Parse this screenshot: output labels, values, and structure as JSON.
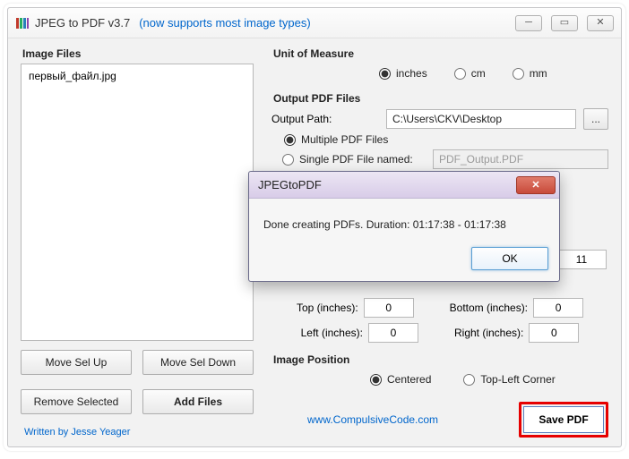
{
  "window": {
    "title": "JPEG to PDF  v3.7",
    "subtitle": "(now supports most image types)"
  },
  "leftpanel": {
    "header": "Image Files",
    "file0": "первый_файл.jpg",
    "move_up": "Move Sel Up",
    "move_down": "Move Sel Down",
    "remove": "Remove Selected",
    "add": "Add Files",
    "credit": "Written by Jesse Yeager"
  },
  "unit": {
    "header": "Unit of Measure",
    "inches": "inches",
    "cm": "cm",
    "mm": "mm"
  },
  "output": {
    "header": "Output PDF Files",
    "path_label": "Output Path:",
    "path_value": "C:\\Users\\CKV\\Desktop",
    "multi": "Multiple PDF Files",
    "single": "Single PDF File named:",
    "single_name": "PDF_Output.PDF"
  },
  "page": {
    "height_value": "11"
  },
  "margins": {
    "top_label": "Top (inches):",
    "top_value": "0",
    "bottom_label": "Bottom (inches):",
    "bottom_value": "0",
    "left_label": "Left (inches):",
    "left_value": "0",
    "right_label": "Right (inches):",
    "right_value": "0"
  },
  "position": {
    "header": "Image Position",
    "centered": "Centered",
    "topleft": "Top-Left Corner"
  },
  "footer": {
    "website": "www.CompulsiveCode.com",
    "save": "Save PDF"
  },
  "dialog": {
    "title": "JPEGtoPDF",
    "message": "Done creating PDFs.  Duration:  01:17:38 - 01:17:38",
    "ok": "OK"
  }
}
